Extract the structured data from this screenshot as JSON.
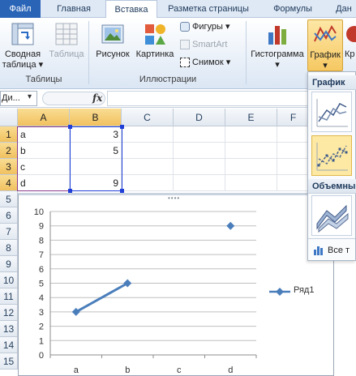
{
  "tabs": [
    "Файл",
    "Главная",
    "Вставка",
    "Разметка страницы",
    "Формулы",
    "Дан"
  ],
  "ribbon": {
    "pivot_label_1": "Сводная",
    "pivot_label_2": "таблица",
    "table_label": "Таблица",
    "group_tables": "Таблицы",
    "picture_label": "Рисунок",
    "clipart_label": "Картинка",
    "shapes_label": "Фигуры",
    "smartart_label": "SmartArt",
    "screenshot_label": "Снимок",
    "group_illustrations": "Иллюстрации",
    "histogram_label": "Гистограмма",
    "line_label": "График",
    "cut_label": "Кр"
  },
  "formula_bar": {
    "name_box": "Ди...",
    "fx": "fx"
  },
  "grid": {
    "columns": [
      "A",
      "B",
      "C",
      "D",
      "E",
      "F"
    ],
    "rows": [
      "1",
      "2",
      "3",
      "4",
      "5",
      "6",
      "7",
      "8",
      "9",
      "10",
      "11",
      "12",
      "13",
      "14",
      "15"
    ],
    "cells": [
      {
        "a": "a",
        "b": "3"
      },
      {
        "a": "b",
        "b": "5"
      },
      {
        "a": "c",
        "b": ""
      },
      {
        "a": "d",
        "b": "9"
      }
    ]
  },
  "chart_data": {
    "type": "line",
    "categories": [
      "a",
      "b",
      "c",
      "d"
    ],
    "series": [
      {
        "name": "Ряд1",
        "values": [
          3,
          5,
          null,
          9
        ]
      }
    ],
    "ylim": [
      0,
      10
    ],
    "yticks": [
      "0",
      "1",
      "2",
      "3",
      "4",
      "5",
      "6",
      "7",
      "8",
      "9",
      "10"
    ],
    "legend": "right",
    "grid": true,
    "color": "#4a7ebb"
  },
  "dropdown": {
    "header_line": "График",
    "header_3d": "Объемны",
    "all_types": "Все т"
  }
}
